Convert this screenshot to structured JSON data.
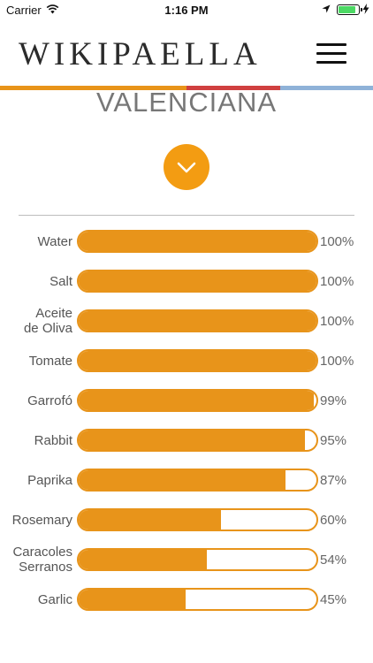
{
  "status_bar": {
    "carrier": "Carrier",
    "time": "1:16 PM",
    "battery_color": "#4cd964"
  },
  "header": {
    "logo": "WIKIPAELLA",
    "menu_icon": "hamburger-menu-icon"
  },
  "accent_strip": [
    {
      "color": "#e8941a",
      "share": 0.5
    },
    {
      "color": "#d04040",
      "share": 0.25
    },
    {
      "color": "#8fb2d8",
      "share": 0.25
    }
  ],
  "section_title": "VALENCIANA",
  "expand_button": {
    "icon": "chevron-down-icon",
    "color": "#f39c12"
  },
  "bar_color": "#e8941a",
  "ingredients": [
    {
      "name": "Water",
      "percent_label": "100%",
      "value": 1.0
    },
    {
      "name": "Salt",
      "percent_label": "100%",
      "value": 1.0
    },
    {
      "name": "Aceite\nde Oliva",
      "percent_label": "100%",
      "value": 1.0
    },
    {
      "name": "Tomate",
      "percent_label": "100%",
      "value": 1.0
    },
    {
      "name": "Garrofó",
      "percent_label": "99%",
      "value": 0.99
    },
    {
      "name": "Rabbit",
      "percent_label": "95%",
      "value": 0.95
    },
    {
      "name": "Paprika",
      "percent_label": "87%",
      "value": 0.87
    },
    {
      "name": "Rosemary",
      "percent_label": "60%",
      "value": 0.6
    },
    {
      "name": "Caracoles\nSerranos",
      "percent_label": "54%",
      "value": 0.54
    },
    {
      "name": "Garlic",
      "percent_label": "45%",
      "value": 0.45
    }
  ]
}
